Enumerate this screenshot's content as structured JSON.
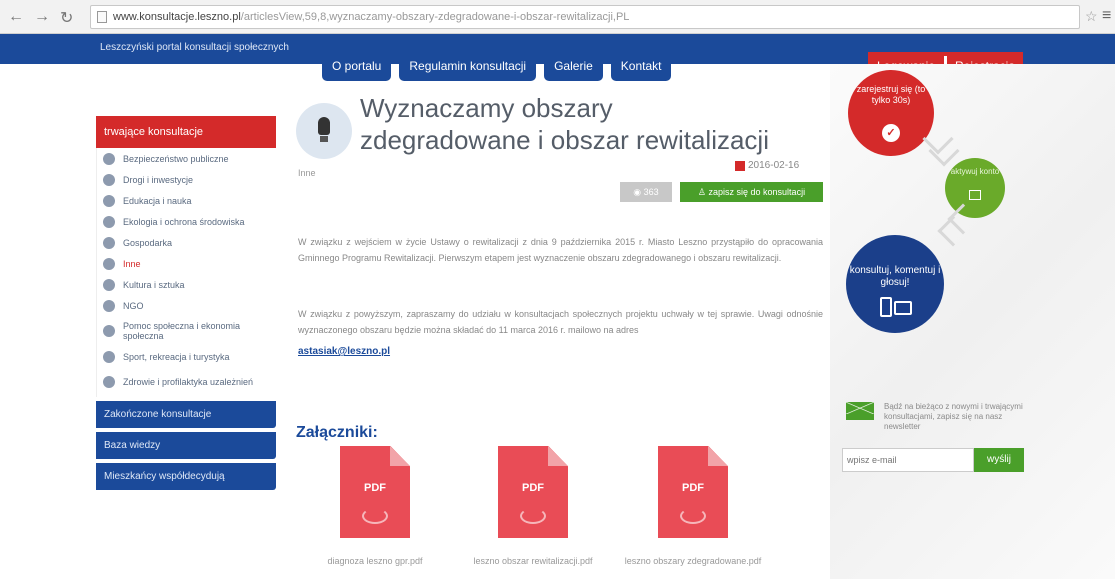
{
  "browser": {
    "url_domain": "www.konsultacje.leszno.pl",
    "url_path": "/articlesView,59,8,wyznaczamy-obszary-zdegradowane-i-obszar-rewitalizacji,PL"
  },
  "header": {
    "portal_title": "Leszczyński portal konsultacji społecznych",
    "nav": [
      "O portalu",
      "Regulamin konsultacji",
      "Galerie",
      "Kontakt"
    ],
    "login": "Logowanie",
    "register": "Rejestracja"
  },
  "sidebar": {
    "header": "trwające konsultacje",
    "items": [
      {
        "label": "Bezpieczeństwo publiczne",
        "icon": "shield-icon"
      },
      {
        "label": "Drogi i inwestycje",
        "icon": "road-icon"
      },
      {
        "label": "Edukacja i nauka",
        "icon": "graduation-cap-icon"
      },
      {
        "label": "Ekologia i ochrona środowiska",
        "icon": "leaf-icon"
      },
      {
        "label": "Gospodarka",
        "icon": "briefcase-icon"
      },
      {
        "label": "Inne",
        "icon": "lightbulb-icon"
      },
      {
        "label": "Kultura i sztuka",
        "icon": "theater-masks-icon"
      },
      {
        "label": "NGO",
        "icon": "building-icon"
      },
      {
        "label": "Pomoc społeczna i ekonomia społeczna",
        "icon": "people-icon"
      },
      {
        "label": "Sport, rekreacja i turystyka",
        "icon": "ball-icon"
      },
      {
        "label": "Zdrowie i profilaktyka uzależnień",
        "icon": "heart-icon"
      }
    ],
    "buttons": [
      "Zakończone konsultacje",
      "Baza wiedzy",
      "Mieszkańcy współdecydują"
    ]
  },
  "article": {
    "title": "Wyznaczamy obszary zdegradowane i obszar rewitalizacji",
    "category": "Inne",
    "date": "2016-02-16",
    "views": "363",
    "subscribe": "zapisz się do konsultacji",
    "p1": "W związku z wejściem w życie Ustawy o rewitalizacji z dnia 9 października 2015 r. Miasto Leszno przystąpiło do opracowania Gminnego Programu Rewitalizacji. Pierwszym etapem jest wyznaczenie obszaru zdegradowanego i obszaru rewitalizacji.",
    "p2": "W związku z powyższym, zapraszamy do udziału w konsultacjach społecznych projektu uchwały w tej sprawie. Uwagi odnośnie wyznaczonego obszaru będzie można składać do 11 marca 2016 r. mailowo na adres",
    "email": "astasiak@leszno.pl",
    "attachments_title": "Załączniki:",
    "attachments": [
      {
        "type": "PDF",
        "name": "diagnoza leszno gpr.pdf"
      },
      {
        "type": "PDF",
        "name": "leszno obszar rewitalizacji.pdf"
      },
      {
        "type": "PDF",
        "name": "leszno obszary zdegradowane.pdf"
      }
    ]
  },
  "right": {
    "register_circle": "zarejestruj się (to tylko 30s)",
    "activate_circle": "aktywuj konto",
    "consult_circle": "konsultuj, komentuj i głosuj!",
    "newsletter_text": "Bądź na bieżąco z nowymi i trwającymi konsultacjami, zapisz się na nasz newsletter",
    "newsletter_placeholder": "wpisz e-mail",
    "newsletter_button": "wyślij"
  },
  "colors": {
    "brand_blue": "#1b4a9a",
    "brand_red": "#d42a2a",
    "brand_green": "#4a9f2a",
    "pdf_red": "#e94c56"
  }
}
